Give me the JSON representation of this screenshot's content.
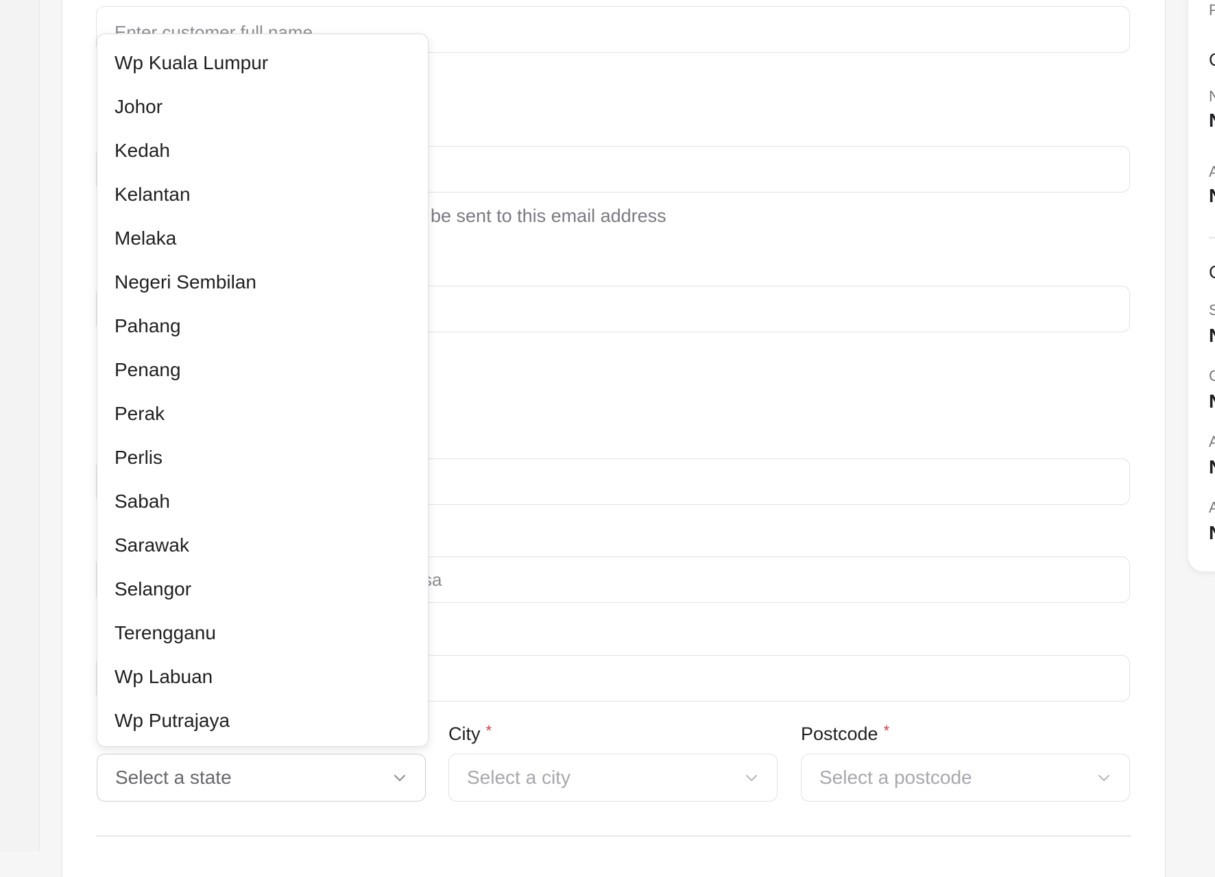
{
  "form": {
    "name_placeholder": "Enter customer full name",
    "email_helper": "be sent to this email address",
    "partial_value": "sa",
    "state": {
      "placeholder": "Select a state"
    },
    "city": {
      "label": "City",
      "required": "*",
      "placeholder": "Select a city"
    },
    "postcode": {
      "label": "Postcode",
      "required": "*",
      "placeholder": "Select a postcode"
    }
  },
  "dropdown": {
    "options": [
      "Wp Kuala Lumpur",
      "Johor",
      "Kedah",
      "Kelantan",
      "Melaka",
      "Negeri Sembilan",
      "Pahang",
      "Penang",
      "Perak",
      "Perlis",
      "Sabah",
      "Sarawak",
      "Selangor",
      "Terengganu",
      "Wp Labuan",
      "Wp Putrajaya"
    ]
  },
  "right_panel": {
    "items": [
      "P",
      "C",
      "N",
      "N",
      "A",
      "N",
      "C",
      "S",
      "N",
      "C",
      "N",
      "A",
      "N",
      "A",
      "N"
    ]
  },
  "colors": {
    "required": "#d93b3b",
    "border": "#e2e2e5"
  },
  "icons": {
    "select_chevron": "chevron-down-icon"
  }
}
